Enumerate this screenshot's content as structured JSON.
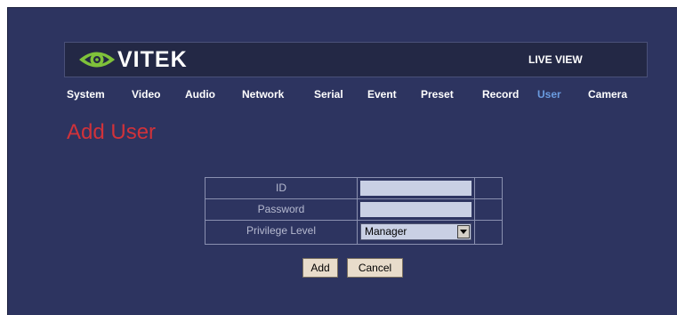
{
  "header": {
    "logo_text": "VITEK",
    "live_view_label": "LIVE VIEW"
  },
  "nav": {
    "items": [
      {
        "label": "System"
      },
      {
        "label": "Video"
      },
      {
        "label": "Audio"
      },
      {
        "label": "Network"
      },
      {
        "label": "Serial"
      },
      {
        "label": "Event"
      },
      {
        "label": "Preset"
      },
      {
        "label": "Record"
      },
      {
        "label": "User"
      },
      {
        "label": "Camera"
      }
    ],
    "active": "User"
  },
  "page": {
    "title": "Add User"
  },
  "form": {
    "id_label": "ID",
    "id_value": "",
    "password_label": "Password",
    "password_value": "",
    "privilege_label": "Privilege Level",
    "privilege_value": "Manager"
  },
  "buttons": {
    "add_label": "Add",
    "cancel_label": "Cancel"
  },
  "colors": {
    "background": "#2d3460",
    "title": "#d0323a",
    "active_nav": "#6a9be0",
    "logo_green": "#7fc23a"
  }
}
